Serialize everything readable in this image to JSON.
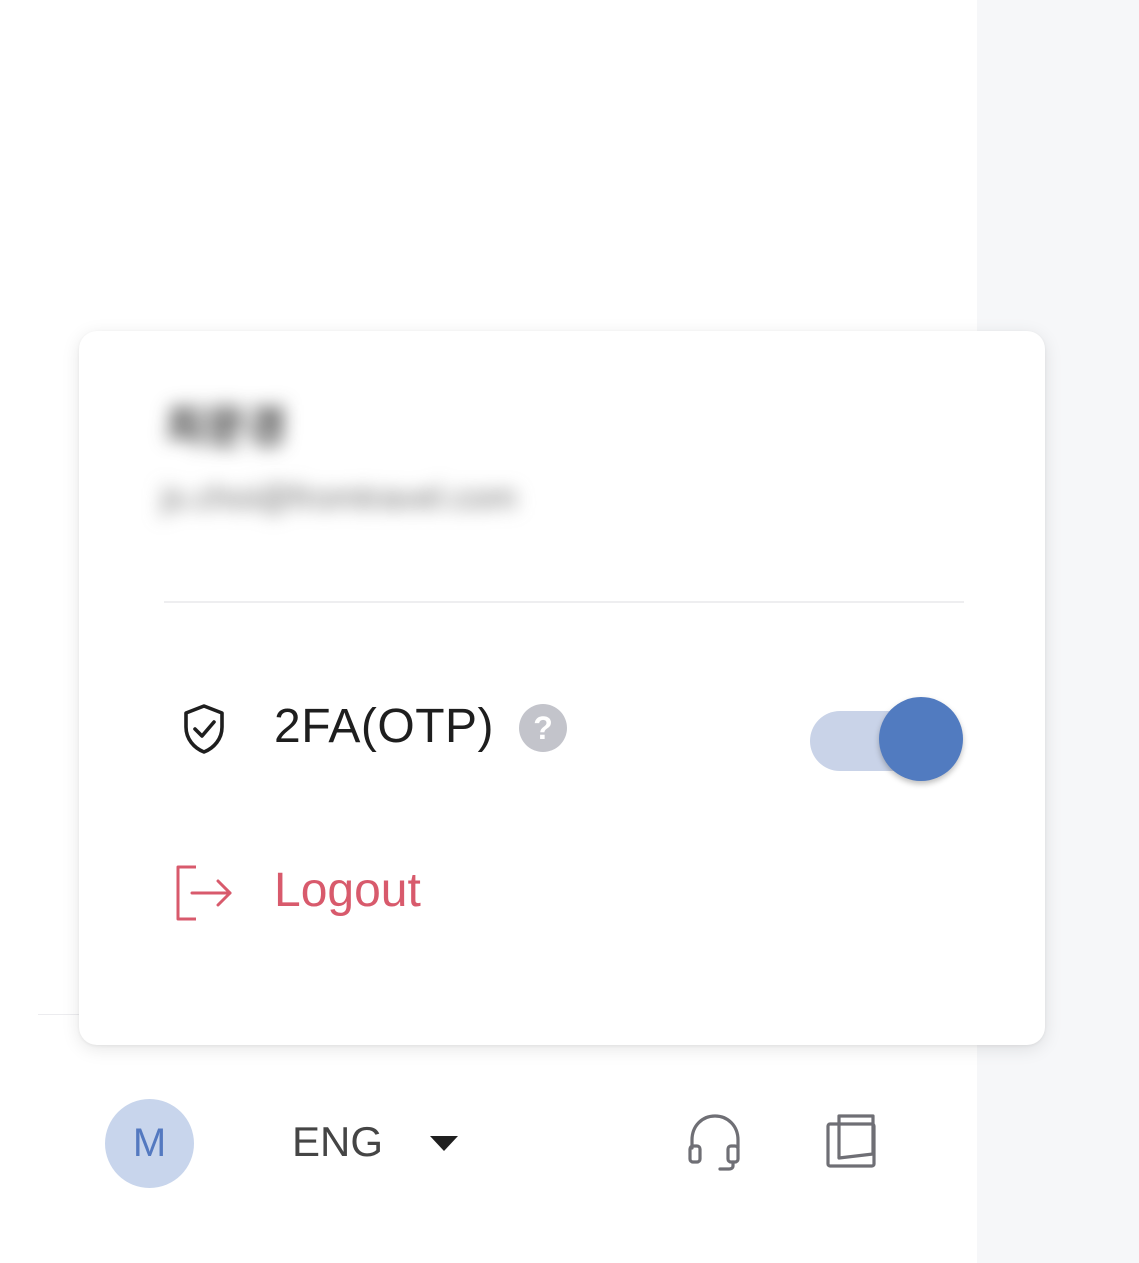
{
  "user_menu": {
    "user_name": "최문경",
    "user_email": "js.choi@fromtravel.com",
    "twofa": {
      "icon": "shield-check-icon",
      "label": "2FA(OTP)",
      "help_glyph": "?",
      "enabled": true
    },
    "logout": {
      "icon": "logout-icon",
      "label": "Logout"
    }
  },
  "bottom_bar": {
    "avatar_initial": "M",
    "language": {
      "selected": "ENG",
      "icon": "chevron-down-icon"
    },
    "support_icon": "headset-icon",
    "docs_icon": "book-icon"
  },
  "colors": {
    "accent": "#517bc0",
    "toggle_track": "#c9d3e8",
    "logout": "#d85a6c",
    "help_badge": "#c3c4cb",
    "avatar_bg": "#c8d5ec",
    "side_panel": "#f6f7f9"
  }
}
